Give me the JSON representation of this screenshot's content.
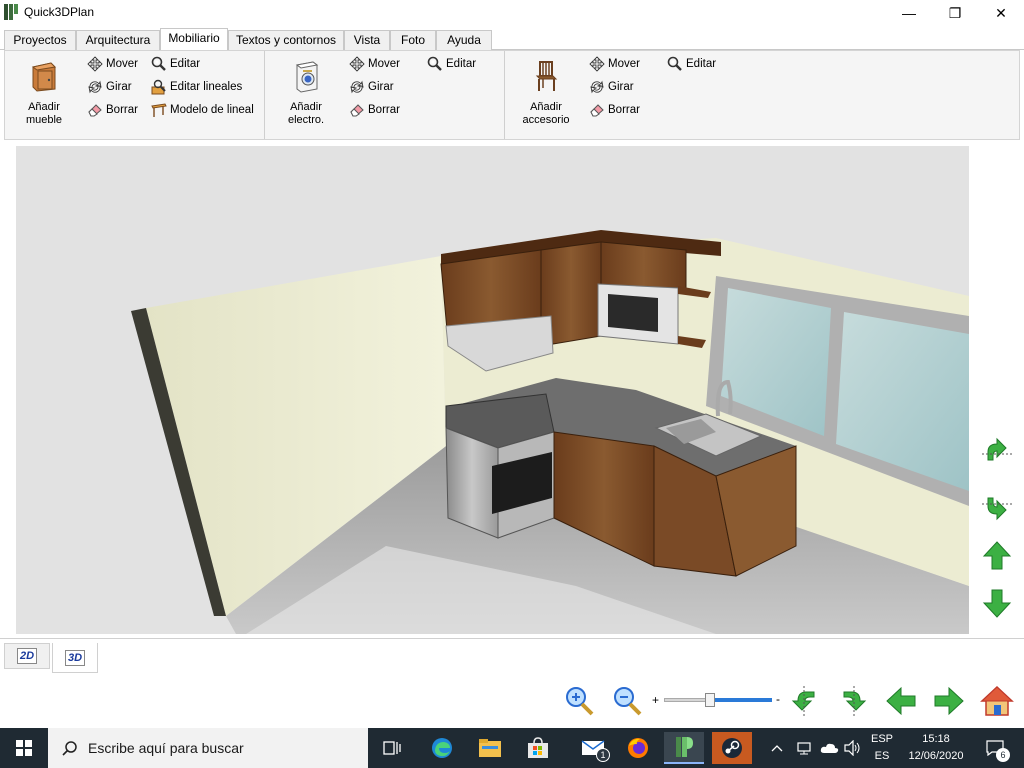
{
  "window": {
    "title": "Quick3DPlan",
    "minimize": "—",
    "maximize": "❐",
    "close": "✕"
  },
  "tabs": [
    {
      "label": "Proyectos"
    },
    {
      "label": "Arquitectura"
    },
    {
      "label": "Mobiliario",
      "active": true
    },
    {
      "label": "Textos y contornos"
    },
    {
      "label": "Vista"
    },
    {
      "label": "Foto"
    },
    {
      "label": "Ayuda"
    }
  ],
  "ribbon": {
    "furniture": {
      "add_label_1": "Añadir",
      "add_label_2": "mueble",
      "move": "Mover",
      "rotate": "Girar",
      "delete": "Borrar",
      "edit": "Editar",
      "edit_linear": "Editar lineales",
      "linear_model": "Modelo de lineal"
    },
    "appliance": {
      "add_label_1": "Añadir",
      "add_label_2": "electro.",
      "move": "Mover",
      "rotate": "Girar",
      "delete": "Borrar",
      "edit": "Editar"
    },
    "accessory": {
      "add_label_1": "Añadir",
      "add_label_2": "accesorio",
      "move": "Mover",
      "rotate": "Girar",
      "delete": "Borrar",
      "edit": "Editar"
    }
  },
  "viewtabs": {
    "tab_2d": "2D",
    "tab_3d": "3D",
    "active": "3D"
  },
  "zoom": {
    "plus": "+",
    "minus": "-",
    "level": 0.43
  },
  "taskbar": {
    "search_placeholder": "Escribe aquí para buscar",
    "mail_badge": "1",
    "lang_top": "ESP",
    "lang_bottom": "ES",
    "time": "15:18",
    "date": "12/06/2020",
    "notifications": "6"
  },
  "colors": {
    "wall": "#efefd8",
    "wood": "#7a4a26",
    "counter": "#6e6e6e",
    "floor": "#b8b8b8",
    "taskbar": "#1f2a33",
    "accent_green": "#3cb043"
  }
}
